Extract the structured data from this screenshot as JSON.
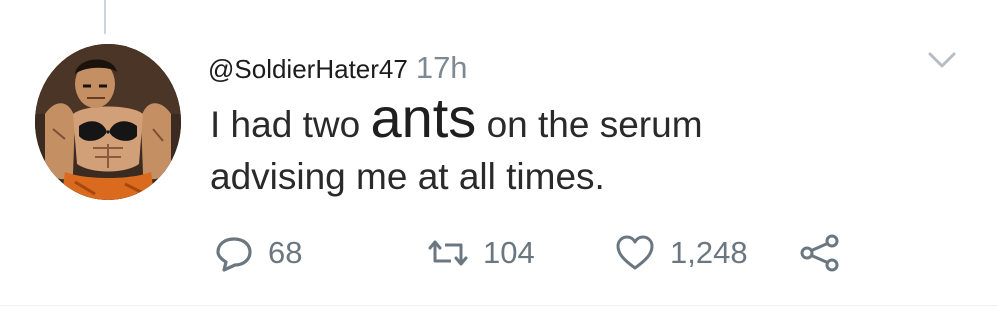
{
  "tweet": {
    "handle": "@SoldierHater47",
    "time": "17h",
    "line1_before": "I had two ",
    "line1_emphasis": "ants",
    "line1_after": " on the serum",
    "line2": "advising me at all times."
  },
  "actions": {
    "replies": "68",
    "retweets": "104",
    "likes": "1,248"
  },
  "icons": {
    "avatar": "cartoon-muscular-character-avatar",
    "menu": "chevron-down-icon",
    "reply": "reply-bubble-icon",
    "retweet": "retweet-icon",
    "like": "heart-icon",
    "share": "share-icon"
  },
  "colors": {
    "text": "#2a2a2a",
    "meta": "#7e8a93",
    "icon": "#6b7780"
  }
}
